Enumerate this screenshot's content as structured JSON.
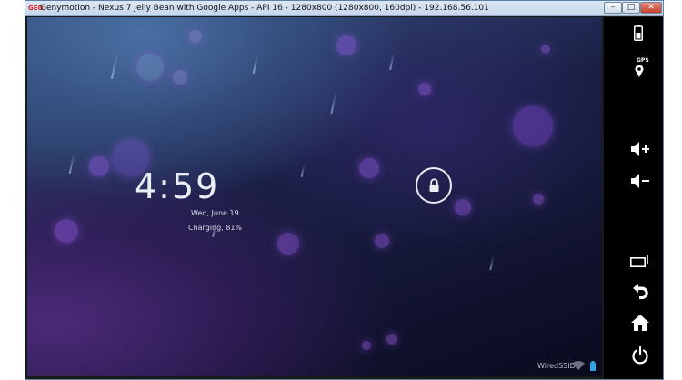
{
  "window": {
    "title": "Genymotion - Nexus 7 Jelly Bean with Google Apps - API 16 - 1280x800 (1280x800, 160dpi) - 192.168.56.101",
    "logo_text": "GEO",
    "minimize_glyph": "–",
    "maximize_glyph": "□",
    "close_glyph": "✕"
  },
  "lockscreen": {
    "time": "4:59",
    "date": "Wed, June 19",
    "charging": "Charging, 81%"
  },
  "statusbar": {
    "ssid": "WiredSSID"
  },
  "sidebar": {
    "gps_label": "GPS"
  },
  "icons": {
    "battery": "battery-icon",
    "gps": "gps-icon",
    "volume_up": "volume-up-icon",
    "volume_down": "volume-down-icon",
    "recent_apps": "recent-apps-icon",
    "back": "back-icon",
    "home": "home-icon",
    "power": "power-icon",
    "lock": "lock-icon",
    "wifi": "wifi-icon"
  },
  "colors": {
    "accent_purple": "#9659e6",
    "clock_text": "#e8ecf3",
    "sidebar_bg": "#000000"
  }
}
